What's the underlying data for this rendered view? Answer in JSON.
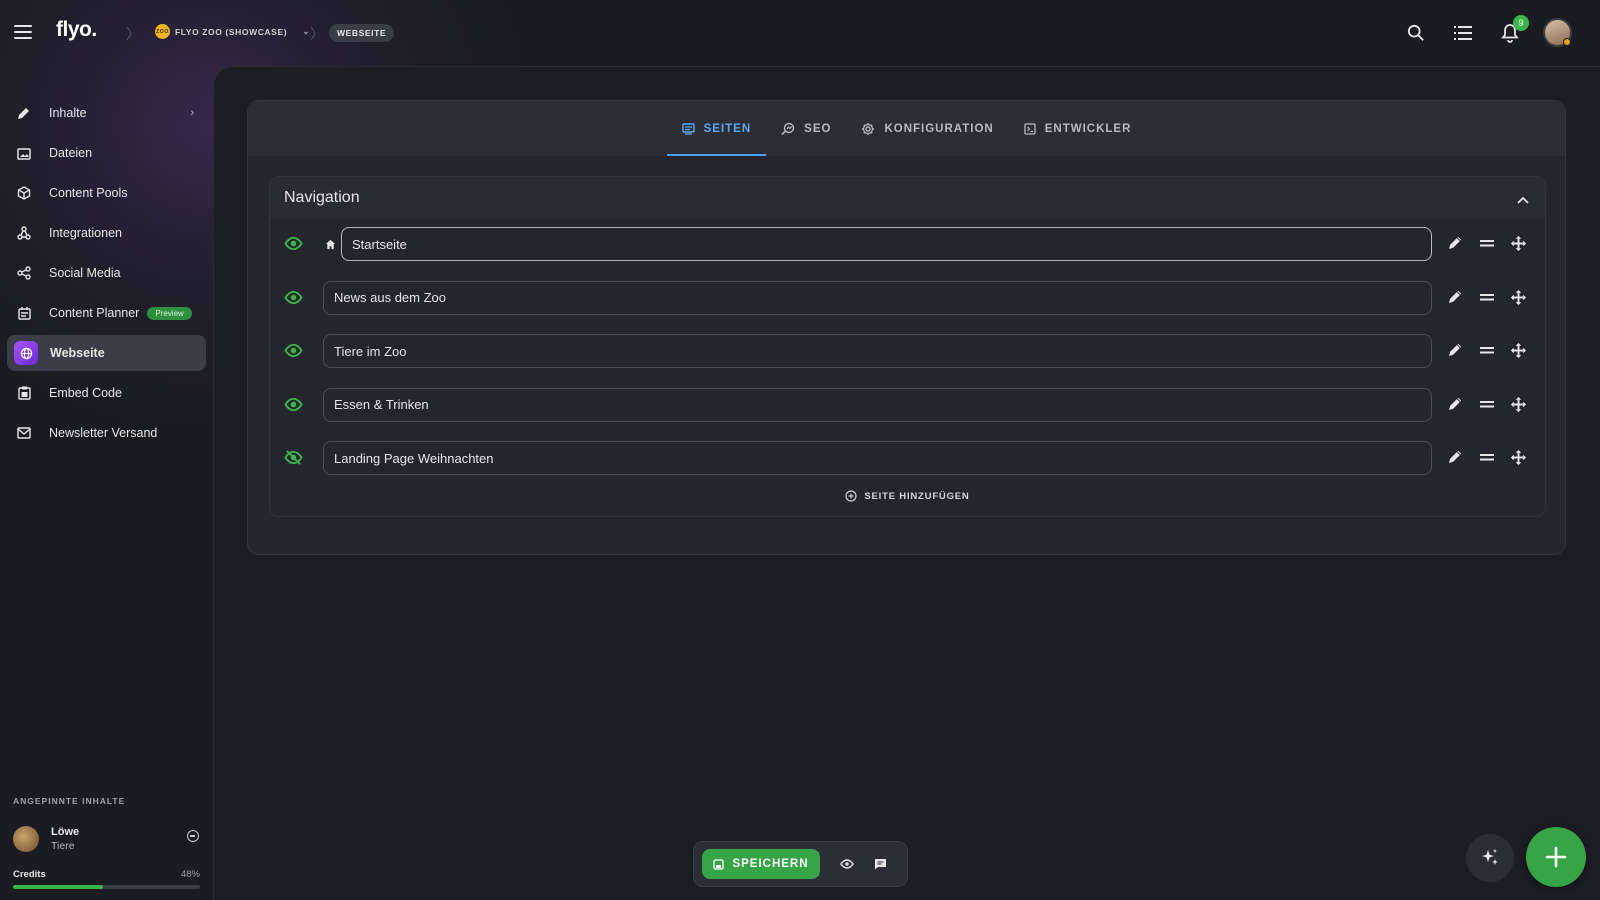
{
  "header": {
    "logo": "flyo.",
    "org_badge": "ZOO",
    "org_name": "FLYO ZOO (SHOWCASE)",
    "page_pill": "WEBSEITE",
    "notifications_count": "9"
  },
  "sidebar": {
    "items": [
      {
        "label": "Inhalte",
        "icon": "pencil-icon"
      },
      {
        "label": "Dateien",
        "icon": "folder-image-icon"
      },
      {
        "label": "Content Pools",
        "icon": "cube-icon"
      },
      {
        "label": "Integrationen",
        "icon": "webhook-icon"
      },
      {
        "label": "Social Media",
        "icon": "share-icon"
      },
      {
        "label": "Content Planner",
        "icon": "planner-icon",
        "badge": "Preview"
      },
      {
        "label": "Webseite",
        "icon": "globe-icon"
      },
      {
        "label": "Embed Code",
        "icon": "embed-icon"
      },
      {
        "label": "Newsletter Versand",
        "icon": "mail-icon"
      }
    ],
    "pinned_title": "ANGEPINNTE INHALTE",
    "pinned": {
      "name": "Löwe",
      "category": "Tiere"
    },
    "credits": {
      "label": "Credits",
      "value": "48%",
      "fraction": 0.48
    }
  },
  "tabs": [
    {
      "label": "SEITEN",
      "icon": "pages-icon",
      "active": true
    },
    {
      "label": "SEO",
      "icon": "seo-icon",
      "active": false
    },
    {
      "label": "KONFIGURATION",
      "icon": "gear-icon",
      "active": false
    },
    {
      "label": "ENTWICKLER",
      "icon": "code-icon",
      "active": false
    }
  ],
  "navigation": {
    "title": "Navigation",
    "pages": [
      {
        "label": "Startseite",
        "visible": true,
        "home": true
      },
      {
        "label": "News aus dem Zoo",
        "visible": true,
        "home": false
      },
      {
        "label": "Tiere im Zoo",
        "visible": true,
        "home": false
      },
      {
        "label": "Essen & Trinken",
        "visible": true,
        "home": false
      },
      {
        "label": "Landing Page Weihnachten",
        "visible": false,
        "home": false
      }
    ],
    "add_label": "SEITE HINZUFÜGEN"
  },
  "toolbar": {
    "save_label": "SPEICHERN"
  },
  "colors": {
    "accent_green": "#37a447",
    "tab_active": "#5aa9f5",
    "webseite_gradient": "#a855f7"
  }
}
